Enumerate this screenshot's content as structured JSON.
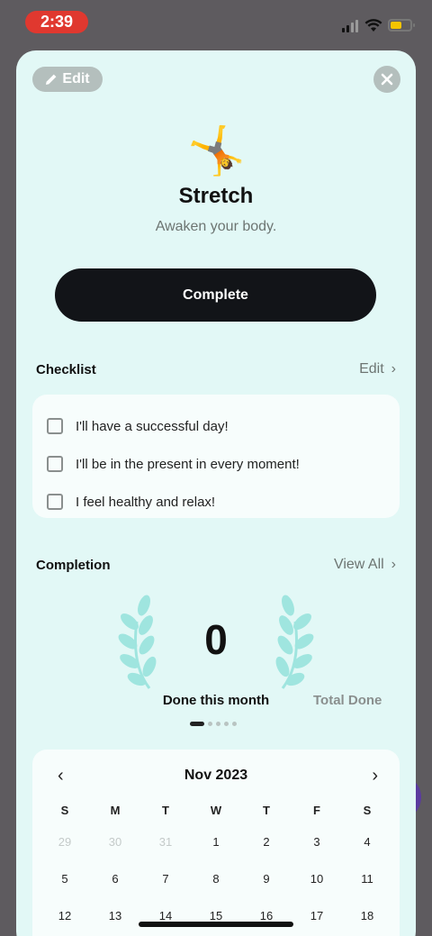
{
  "status_bar": {
    "time": "2:39"
  },
  "header": {
    "edit_label": "Edit",
    "title": "Stretch",
    "subtitle": "Awaken your body.",
    "emoji": "🤸"
  },
  "primary_action": {
    "label": "Complete"
  },
  "checklist": {
    "title": "Checklist",
    "action_label": "Edit",
    "items": [
      {
        "text": "I'll have a successful day!",
        "checked": false
      },
      {
        "text": "I'll be in the present in every moment!",
        "checked": false
      },
      {
        "text": "I feel healthy and relax!",
        "checked": false
      }
    ]
  },
  "completion": {
    "title": "Completion",
    "action_label": "View All",
    "count": "0",
    "stat_label": "Done this month",
    "next_stat_label": "Total Done",
    "page_count": 5,
    "active_page": 1
  },
  "calendar": {
    "month_label": "Nov 2023",
    "prev_icon": "‹",
    "next_icon": "›",
    "weekdays": [
      "S",
      "M",
      "T",
      "W",
      "T",
      "F",
      "S"
    ],
    "weeks": [
      [
        "29",
        "30",
        "31",
        "1",
        "2",
        "3",
        "4"
      ],
      [
        "5",
        "6",
        "7",
        "8",
        "9",
        "10",
        "11"
      ],
      [
        "12",
        "13",
        "14",
        "15",
        "16",
        "17",
        "18"
      ]
    ],
    "muted_days": [
      "29",
      "30",
      "31"
    ]
  },
  "colors": {
    "sheet_bg": "#e2f8f6",
    "laurel": "#9fe5df",
    "button_dark": "#121418",
    "status_time_bg": "#e0382f"
  }
}
